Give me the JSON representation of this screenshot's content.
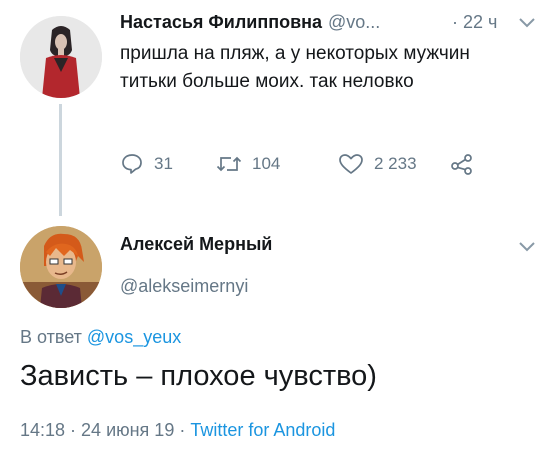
{
  "tweet1": {
    "author_name": "Настасья Филипповна",
    "author_handle": "@vo...",
    "separator": "·",
    "time": "22 ч",
    "text": "пришла на пляж, а у некоторых мужчин титьки больше моих. так неловко",
    "replies": "31",
    "retweets": "104",
    "likes": "2 233"
  },
  "tweet2": {
    "author_name": "Алексей Мерный",
    "author_handle": "@alekseimernyi",
    "reply_prefix": "В ответ",
    "reply_to": "@vos_yeux",
    "text": "Зависть – плохое чувство)",
    "timestamp": "14:18 · 24 июня 19 ·",
    "source": "Twitter for Android"
  },
  "icons": {
    "reply": "comment-bubble-icon",
    "retweet": "retweet-arrows-icon",
    "like": "heart-icon",
    "share": "share-icon",
    "menu": "chevron-down-icon"
  },
  "colors": {
    "text": "#14171a",
    "secondary": "#657786",
    "link": "#1b95e0",
    "thread_line": "#ccd6dd"
  }
}
